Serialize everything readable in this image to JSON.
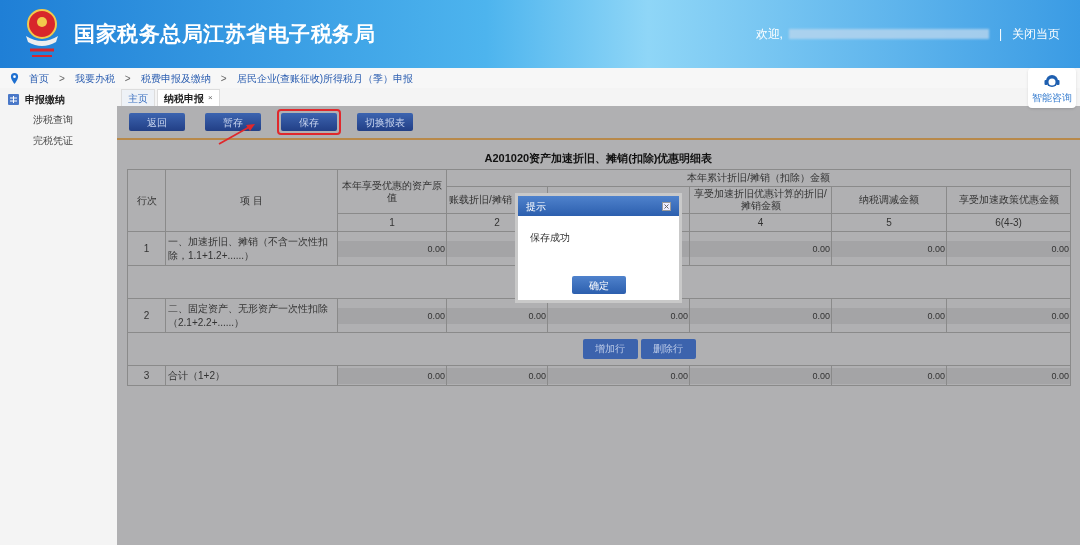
{
  "header": {
    "title": "国家税务总局江苏省电子税务局",
    "welcome": "欢迎,",
    "close_link": "关闭当页",
    "separator": "|"
  },
  "breadcrumb_separator": ">",
  "help_widget": {
    "label": "智能咨询"
  },
  "breadcrumb": [
    "首页",
    "我要办税",
    "税费申报及缴纳",
    "居民企业(查账征收)所得税月（季）申报"
  ],
  "sidebar": {
    "section": "申报缴纳",
    "items": [
      "涉税查询",
      "完税凭证"
    ]
  },
  "tabs": [
    {
      "label": "主页",
      "selected": false,
      "closable": false
    },
    {
      "label": "纳税申报",
      "selected": true,
      "closable": true
    }
  ],
  "close_mark": "×",
  "toolbar": [
    {
      "label": "返回",
      "highlighted": false
    },
    {
      "label": "暂存",
      "highlighted": false
    },
    {
      "label": "保存",
      "highlighted": true
    },
    {
      "label": "切换报表",
      "highlighted": false
    }
  ],
  "table": {
    "title": "A201020资产加速折旧、摊销(扣除)优惠明细表",
    "row_no_header": "行次",
    "item_header": "项 目",
    "group_header": "本年累计折旧/摊销（扣除）金额",
    "columns": [
      {
        "header": "本年享受优惠的资产原值",
        "number": "1"
      },
      {
        "header": "账载折旧/摊销",
        "number": "2"
      },
      {},
      {
        "header": "享受加速折旧优惠计算的折旧/摊销金额",
        "number": "4"
      },
      {
        "header": "纳税调减金额",
        "number": "5"
      },
      {
        "header": "享受加速政策优惠金额",
        "number": "6(4-3)"
      }
    ],
    "rows": [
      {
        "kind": "data",
        "number": "1",
        "label": "一、加速折旧、摊销（不含一次性扣除，1.1+1.2+......）",
        "values": {
          "c1": "0.00",
          "c4": "0.00",
          "c5": "0.00",
          "c6": "0.00"
        }
      },
      {
        "kind": "blank"
      },
      {
        "kind": "data",
        "number": "2",
        "label": "二、固定资产、无形资产一次性扣除（2.1+2.2+......）",
        "values": {
          "c1": "0.00",
          "c2": "0.00",
          "c3": "0.00",
          "c4": "0.00",
          "c5": "0.00",
          "c6": "0.00"
        }
      },
      {
        "kind": "actions",
        "buttons": [
          "增加行",
          "删除行"
        ]
      },
      {
        "kind": "data",
        "number": "3",
        "label": "合计（1+2）",
        "values": {
          "c1": "0.00",
          "c2": "0.00",
          "c3": "0.00",
          "c4": "0.00",
          "c5": "0.00",
          "c6": "0.00"
        }
      }
    ]
  },
  "dialog": {
    "title": "提示",
    "message": "保存成功",
    "button": "确定"
  }
}
